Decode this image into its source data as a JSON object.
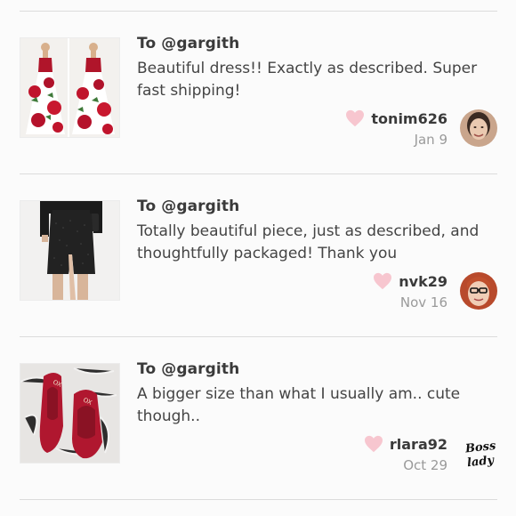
{
  "reviews": [
    {
      "to": "To @gargith",
      "message": "Beautiful dress!! Exactly as described. Super fast shipping!",
      "username": "tonim626",
      "date": "Jan 9",
      "thumbnail_icon": "floral-gown-photo",
      "avatar_icon": "user-photo-avatar"
    },
    {
      "to": "To @gargith",
      "message": "Totally beautiful piece, just as described, and thoughtfully packaged! Thank you",
      "username": "nvk29",
      "date": "Nov 16",
      "thumbnail_icon": "black-skirt-photo",
      "avatar_icon": "user-photo-avatar"
    },
    {
      "to": "To @gargith",
      "message": "A bigger size than what I usually am.. cute though..",
      "username": "rlara92",
      "date": "Oct 29",
      "thumbnail_icon": "red-flats-photo",
      "avatar_icon": "boss-lady-logo-avatar",
      "avatar_text": "Boss Lady"
    }
  ],
  "colors": {
    "heart": "#f7c6cf",
    "divider": "#dcdcdc",
    "date": "#9a9a9a"
  }
}
